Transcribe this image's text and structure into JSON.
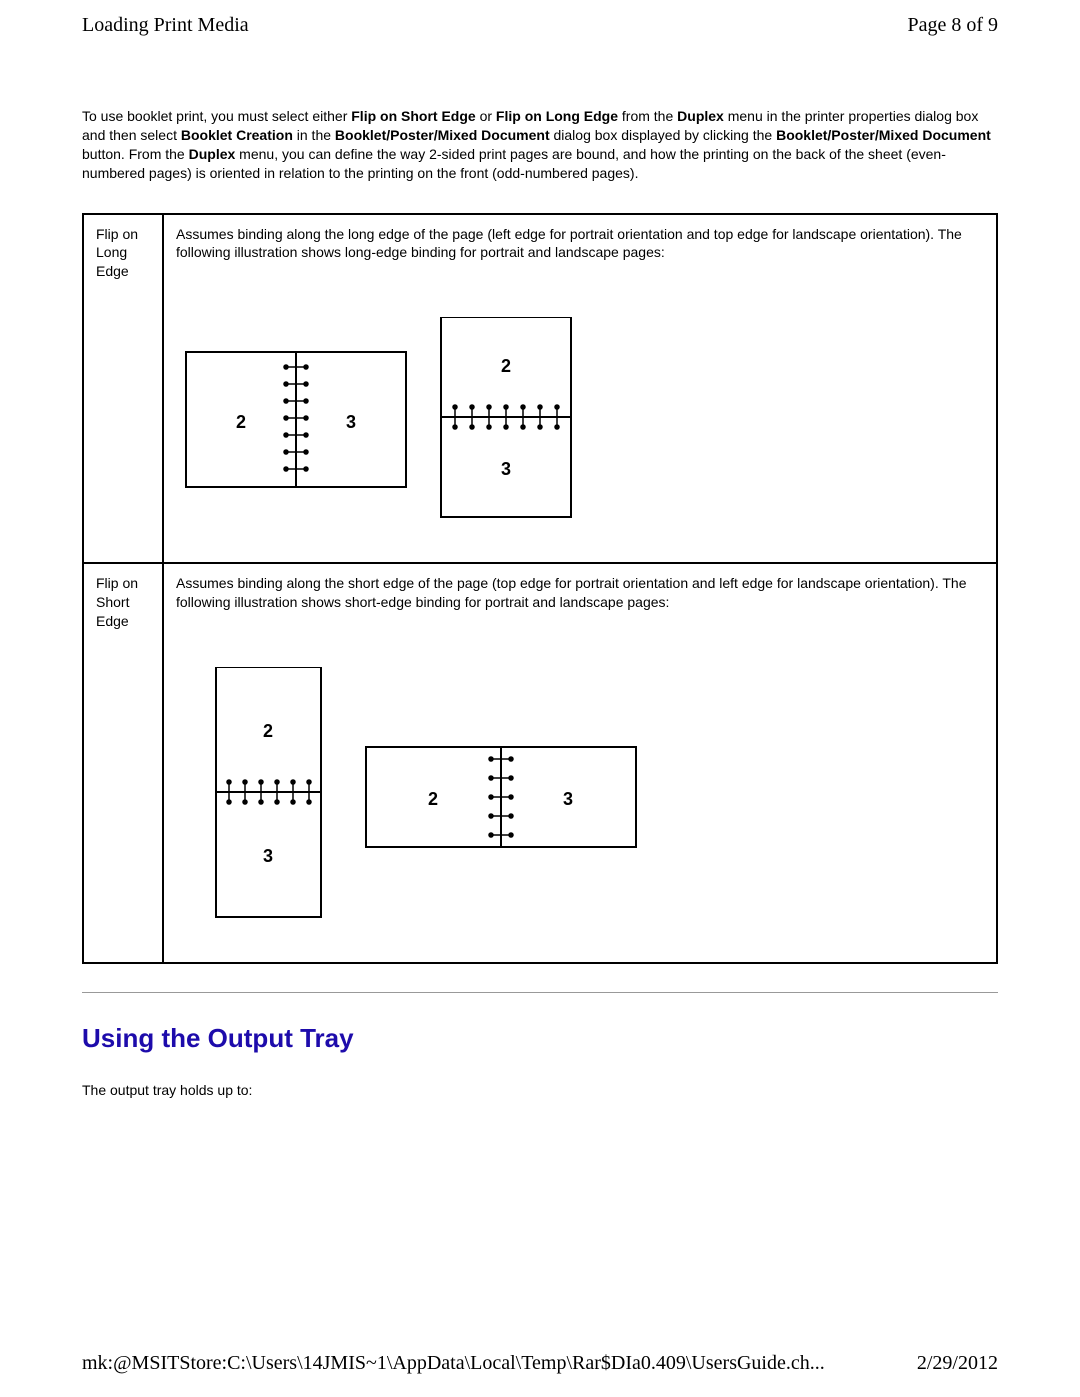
{
  "header": {
    "title": "Loading Print Media",
    "page": "Page 8 of 9"
  },
  "intro": {
    "p1a": "To use booklet print, you must select either ",
    "b1": "Flip on Short Edge",
    "p1b": " or ",
    "b2": "Flip on Long Edge",
    "p1c": " from the ",
    "b3": "Duplex",
    "p1d": " menu in the printer properties dialog box and then select ",
    "b4": "Booklet Creation",
    "p1e": " in the ",
    "b5": "Booklet/Poster/Mixed Document",
    "p1f": " dialog box displayed by clicking the ",
    "b6": "Booklet/Poster/Mixed Document",
    "p1g": " button. From the ",
    "b7": "Duplex",
    "p1h": " menu, you can define the way 2-sided print pages are bound, and how the printing on the back of the sheet (even-numbered pages) is oriented in relation to the printing on the front (odd-numbered pages)."
  },
  "table": {
    "row1": {
      "label": "Flip on Long Edge",
      "desc": "Assumes binding along the long edge of the page (left edge for portrait orientation and top edge for landscape orientation). The following illustration shows long-edge binding for portrait and landscape pages:"
    },
    "row2": {
      "label": "Flip on Short Edge",
      "desc": "Assumes binding along the short edge of the page (top edge for portrait orientation and left edge for landscape orientation). The following illustration shows short-edge binding for portrait and landscape pages:"
    }
  },
  "section": {
    "heading": "Using the Output Tray",
    "body": "The output tray holds up to:"
  },
  "footer": {
    "path": "mk:@MSITStore:C:\\Users\\14JMIS~1\\AppData\\Local\\Temp\\Rar$DIa0.409\\UsersGuide.ch...",
    "date": "2/29/2012"
  },
  "labels": {
    "two": "2",
    "three": "3"
  }
}
